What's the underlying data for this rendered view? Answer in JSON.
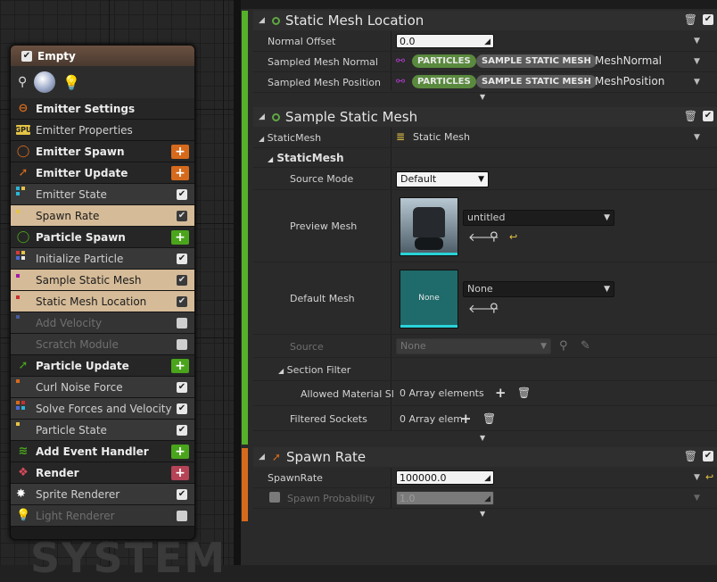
{
  "node": {
    "title": "Empty",
    "sections": [
      {
        "id": "emitter-settings",
        "label": "Emitter Settings",
        "type": "section",
        "icon": "emitter-settings-icon",
        "color": "#d66a1c"
      },
      {
        "id": "emitter-properties",
        "label": "Emitter Properties",
        "type": "section-plain",
        "icon": "gpu-icon"
      },
      {
        "id": "emitter-spawn",
        "label": "Emitter Spawn",
        "type": "section",
        "icon": "emitter-spawn-icon",
        "color": "#d66a1c",
        "add": true
      },
      {
        "id": "emitter-update",
        "label": "Emitter Update",
        "type": "section",
        "icon": "emitter-update-icon",
        "color": "#d66a1c",
        "add": true
      },
      {
        "id": "emitter-state",
        "label": "Emitter State",
        "type": "item",
        "checked": true
      },
      {
        "id": "spawn-rate",
        "label": "Spawn Rate",
        "type": "item",
        "checked": true,
        "highlight": true
      },
      {
        "id": "particle-spawn",
        "label": "Particle Spawn",
        "type": "section",
        "icon": "particle-spawn-icon",
        "color": "#4aa51c",
        "add": true
      },
      {
        "id": "initialize-particle",
        "label": "Initialize Particle",
        "type": "item",
        "checked": true
      },
      {
        "id": "sample-static-mesh",
        "label": "Sample Static Mesh",
        "type": "item",
        "checked": true,
        "highlight": true
      },
      {
        "id": "static-mesh-location",
        "label": "Static Mesh Location",
        "type": "item",
        "checked": true,
        "highlight": true
      },
      {
        "id": "add-velocity",
        "label": "Add Velocity",
        "type": "item",
        "checked": false,
        "disabled": true
      },
      {
        "id": "scratch-module",
        "label": "Scratch Module",
        "type": "item",
        "checked": false,
        "disabled": true
      },
      {
        "id": "particle-update",
        "label": "Particle Update",
        "type": "section",
        "icon": "particle-update-icon",
        "color": "#4aa51c",
        "add": true
      },
      {
        "id": "curl-noise-force",
        "label": "Curl Noise Force",
        "type": "item",
        "checked": true
      },
      {
        "id": "solve-forces",
        "label": "Solve Forces and Velocity",
        "type": "item",
        "checked": true
      },
      {
        "id": "particle-state",
        "label": "Particle State",
        "type": "item",
        "checked": true
      },
      {
        "id": "add-event-handler",
        "label": "Add Event Handler",
        "type": "section",
        "icon": "event-handler-icon",
        "color": "#4aa51c",
        "add": true
      },
      {
        "id": "render",
        "label": "Render",
        "type": "section",
        "icon": "render-icon",
        "color": "#b64356",
        "add": true
      },
      {
        "id": "sprite-renderer",
        "label": "Sprite Renderer",
        "type": "item",
        "checked": true,
        "icon": "sprite-icon"
      },
      {
        "id": "light-renderer",
        "label": "Light Renderer",
        "type": "item",
        "checked": false,
        "disabled": true,
        "icon": "light-icon"
      }
    ]
  },
  "watermark": "SYSTEM",
  "location": {
    "title": "Static Mesh Location",
    "normal_offset_label": "Normal Offset",
    "normal_offset_value": "0.0",
    "sampled_normal_label": "Sampled Mesh Normal",
    "sampled_normal_tags": [
      "PARTICLES",
      "SAMPLE STATIC MESH"
    ],
    "sampled_normal_value": "MeshNormal",
    "sampled_position_label": "Sampled Mesh Position",
    "sampled_position_tags": [
      "PARTICLES",
      "SAMPLE STATIC MESH"
    ],
    "sampled_position_value": "MeshPosition"
  },
  "sample": {
    "title": "Sample Static Mesh",
    "static_mesh_label": "StaticMesh",
    "static_mesh_value": "Static Mesh",
    "group_label": "StaticMesh",
    "source_mode_label": "Source Mode",
    "source_mode_value": "Default",
    "preview_mesh_label": "Preview Mesh",
    "preview_mesh_value": "untitled",
    "default_mesh_label": "Default Mesh",
    "default_mesh_thumb": "None",
    "default_mesh_value": "None",
    "source_label": "Source",
    "source_value": "None",
    "section_filter_label": "Section Filter",
    "allowed_material_label": "Allowed Material Sl",
    "allowed_material_value": "0 Array elements",
    "filtered_sockets_label": "Filtered Sockets",
    "filtered_sockets_value": "0 Array elem"
  },
  "spawn": {
    "title": "Spawn Rate",
    "spawnrate_label": "SpawnRate",
    "spawnrate_value": "100000.0",
    "probability_label": "Spawn Probability",
    "probability_value": "1.0"
  }
}
